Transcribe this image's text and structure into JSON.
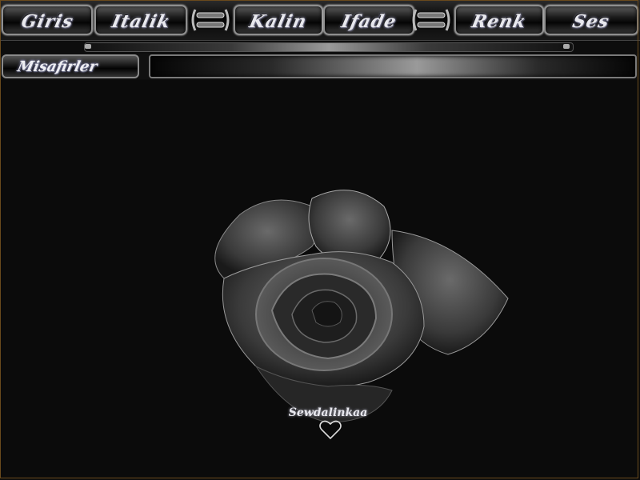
{
  "toolbar": {
    "buttons": [
      {
        "label": "Giris"
      },
      {
        "label": "Italik"
      },
      {
        "label": "Kalin"
      },
      {
        "label": "Ifade"
      },
      {
        "label": "Renk"
      },
      {
        "label": "Ses"
      }
    ]
  },
  "guest_row": {
    "guests_label": "Misafirler"
  },
  "content": {
    "signature": "Sewdalinkaa"
  },
  "colors": {
    "background": "#0d0d0d",
    "chrome": "#8f8f8f",
    "text": "#e8e8ee",
    "frame_border": "#6a4a1c"
  },
  "icons": {
    "connector": "chain-link-icon",
    "heart": "heart-icon"
  }
}
